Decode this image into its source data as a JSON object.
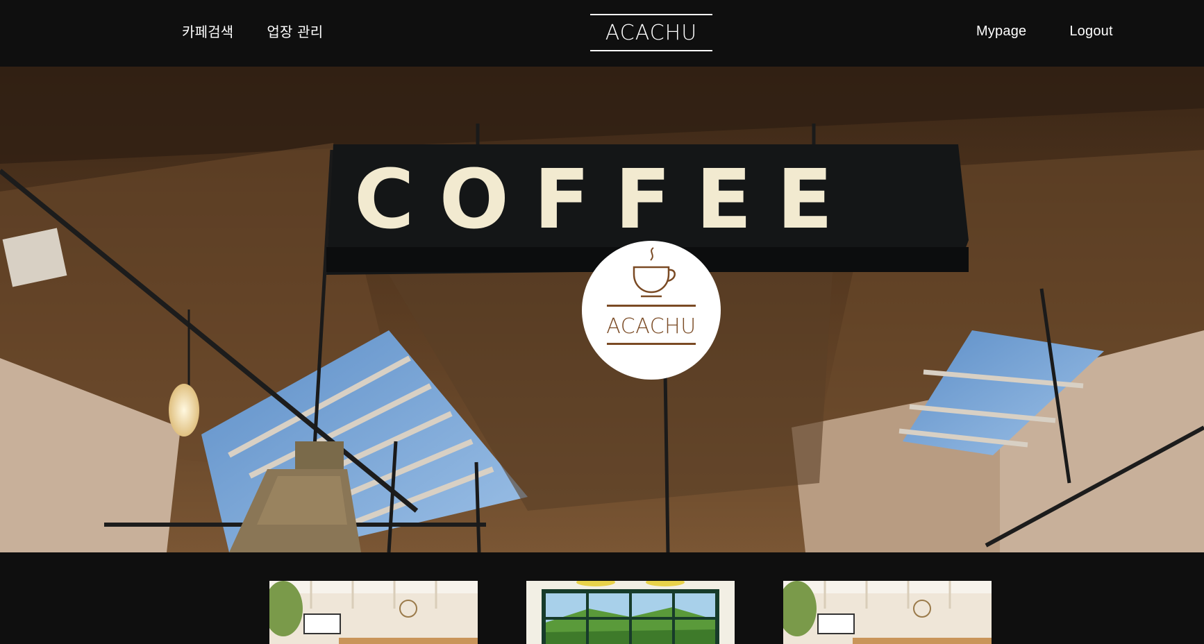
{
  "header": {
    "nav_left": [
      {
        "label": "카페검색"
      },
      {
        "label": "업장 관리"
      }
    ],
    "brand": "ACACHU",
    "nav_right": [
      {
        "label": "Mypage"
      },
      {
        "label": "Logout"
      }
    ]
  },
  "hero": {
    "sign_text": "COFFEE",
    "logo_text": "ACACHU",
    "icon": "coffee-cup-icon"
  },
  "cards": [
    {
      "name": "cafe-card-1",
      "icon": "cafe-interior-photo"
    },
    {
      "name": "cafe-card-2",
      "icon": "mountain-window-photo"
    },
    {
      "name": "cafe-card-3",
      "icon": "cafe-interior-photo"
    }
  ],
  "colors": {
    "background": "#0f0f0f",
    "accent_brown": "#7a4a24",
    "text": "#ffffff"
  }
}
